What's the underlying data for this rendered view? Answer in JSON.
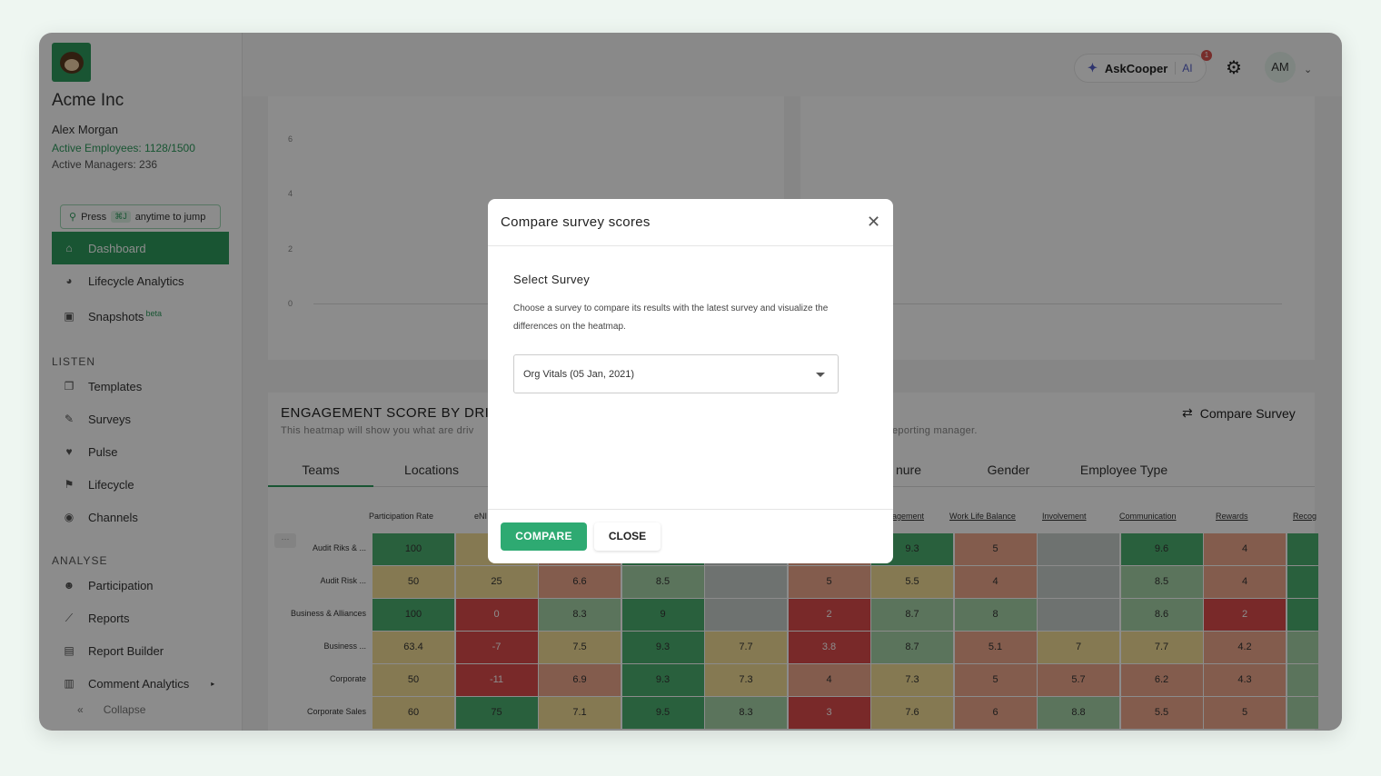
{
  "company": "Acme Inc",
  "user": {
    "name": "Alex Morgan",
    "active_employees": "Active Employees: 1128/1500",
    "active_managers": "Active Managers: 236",
    "initials": "AM"
  },
  "jump": {
    "press": "Press",
    "kbd": "⌘J",
    "rest": "anytime to jump"
  },
  "nav": {
    "dashboard": "Dashboard",
    "lifecycle_analytics": "Lifecycle Analytics",
    "snapshots": "Snapshots",
    "beta": "beta",
    "listen_section": "LISTEN",
    "templates": "Templates",
    "surveys": "Surveys",
    "pulse": "Pulse",
    "lifecycle": "Lifecycle",
    "channels": "Channels",
    "analyse_section": "ANALYSE",
    "participation": "Participation",
    "reports": "Reports",
    "report_builder": "Report Builder",
    "comment_analytics": "Comment Analytics",
    "collapse": "Collapse"
  },
  "topbar": {
    "ask": "AskCooper",
    "ai": "AI",
    "notif_count": "1"
  },
  "chart_ticks": [
    "6",
    "4",
    "2",
    "0"
  ],
  "heatmap": {
    "title": "ENGAGEMENT SCORE BY DRIVI",
    "subtitle": "This heatmap will show you what are driv",
    "subtitle_right": "eporting manager.",
    "compare_survey": "Compare Survey",
    "tabs": [
      "Teams",
      "Locations",
      "nure",
      "Gender",
      "Employee Type"
    ],
    "columns": [
      "Participation Rate",
      "eNI",
      "agement",
      "Work Life Balance",
      "Involvement",
      "Communication",
      "Rewards",
      "Recog"
    ],
    "rows": [
      {
        "label": "Audit Riks & ...",
        "cells": [
          [
            "100",
            "g"
          ],
          [
            "",
            "y"
          ],
          [
            "",
            "o"
          ],
          [
            "",
            "g"
          ],
          [
            "",
            "gr"
          ],
          [
            "",
            "o"
          ],
          [
            "9.3",
            "g"
          ],
          [
            "5",
            "o"
          ],
          [
            "",
            "gr"
          ],
          [
            "9.6",
            "g"
          ],
          [
            "4",
            "o"
          ],
          [
            "",
            "g"
          ]
        ]
      },
      {
        "label": "Audit Risk ...",
        "cells": [
          [
            "50",
            "y"
          ],
          [
            "25",
            "y"
          ],
          [
            "6.6",
            "o"
          ],
          [
            "8.5",
            "lg"
          ],
          [
            "",
            "gr"
          ],
          [
            "5",
            "o"
          ],
          [
            "5.5",
            "y"
          ],
          [
            "4",
            "o"
          ],
          [
            "",
            "gr"
          ],
          [
            "8.5",
            "lg"
          ],
          [
            "4",
            "o"
          ],
          [
            "",
            "g"
          ]
        ]
      },
      {
        "label": "Business & Alliances",
        "cells": [
          [
            "100",
            "g"
          ],
          [
            "0",
            "r"
          ],
          [
            "8.3",
            "lg"
          ],
          [
            "9",
            "g"
          ],
          [
            "",
            "gr"
          ],
          [
            "2",
            "r"
          ],
          [
            "8.7",
            "lg"
          ],
          [
            "8",
            "lg"
          ],
          [
            "",
            "gr"
          ],
          [
            "8.6",
            "lg"
          ],
          [
            "2",
            "r"
          ],
          [
            "",
            "g"
          ]
        ]
      },
      {
        "label": "Business ...",
        "cells": [
          [
            "63.4",
            "y"
          ],
          [
            "-7",
            "r"
          ],
          [
            "7.5",
            "y"
          ],
          [
            "9.3",
            "g"
          ],
          [
            "7.7",
            "y"
          ],
          [
            "3.8",
            "r"
          ],
          [
            "8.7",
            "lg"
          ],
          [
            "5.1",
            "o"
          ],
          [
            "7",
            "y"
          ],
          [
            "7.7",
            "y"
          ],
          [
            "4.2",
            "o"
          ],
          [
            "",
            "lg"
          ]
        ]
      },
      {
        "label": "Corporate",
        "cells": [
          [
            "50",
            "y"
          ],
          [
            "-11",
            "r"
          ],
          [
            "6.9",
            "o"
          ],
          [
            "9.3",
            "g"
          ],
          [
            "7.3",
            "y"
          ],
          [
            "4",
            "o"
          ],
          [
            "7.3",
            "y"
          ],
          [
            "5",
            "o"
          ],
          [
            "5.7",
            "o"
          ],
          [
            "6.2",
            "o"
          ],
          [
            "4.3",
            "o"
          ],
          [
            "",
            "lg"
          ]
        ]
      },
      {
        "label": "Corporate Sales",
        "cells": [
          [
            "60",
            "y"
          ],
          [
            "75",
            "g"
          ],
          [
            "7.1",
            "y"
          ],
          [
            "9.5",
            "g"
          ],
          [
            "8.3",
            "lg"
          ],
          [
            "3",
            "r"
          ],
          [
            "7.6",
            "y"
          ],
          [
            "6",
            "o"
          ],
          [
            "8.8",
            "lg"
          ],
          [
            "5.5",
            "o"
          ],
          [
            "5",
            "o"
          ],
          [
            "",
            "lg"
          ]
        ]
      }
    ]
  },
  "modal": {
    "title": "Compare survey scores",
    "label": "Select Survey",
    "description": "Choose a survey to compare its results with the latest survey and visualize the differences on the heatmap.",
    "selected": "Org Vitals (05 Jan, 2021)",
    "compare": "COMPARE",
    "close": "CLOSE"
  },
  "colors": {
    "brand": "#2e9b5e",
    "accent": "#5560c8"
  }
}
